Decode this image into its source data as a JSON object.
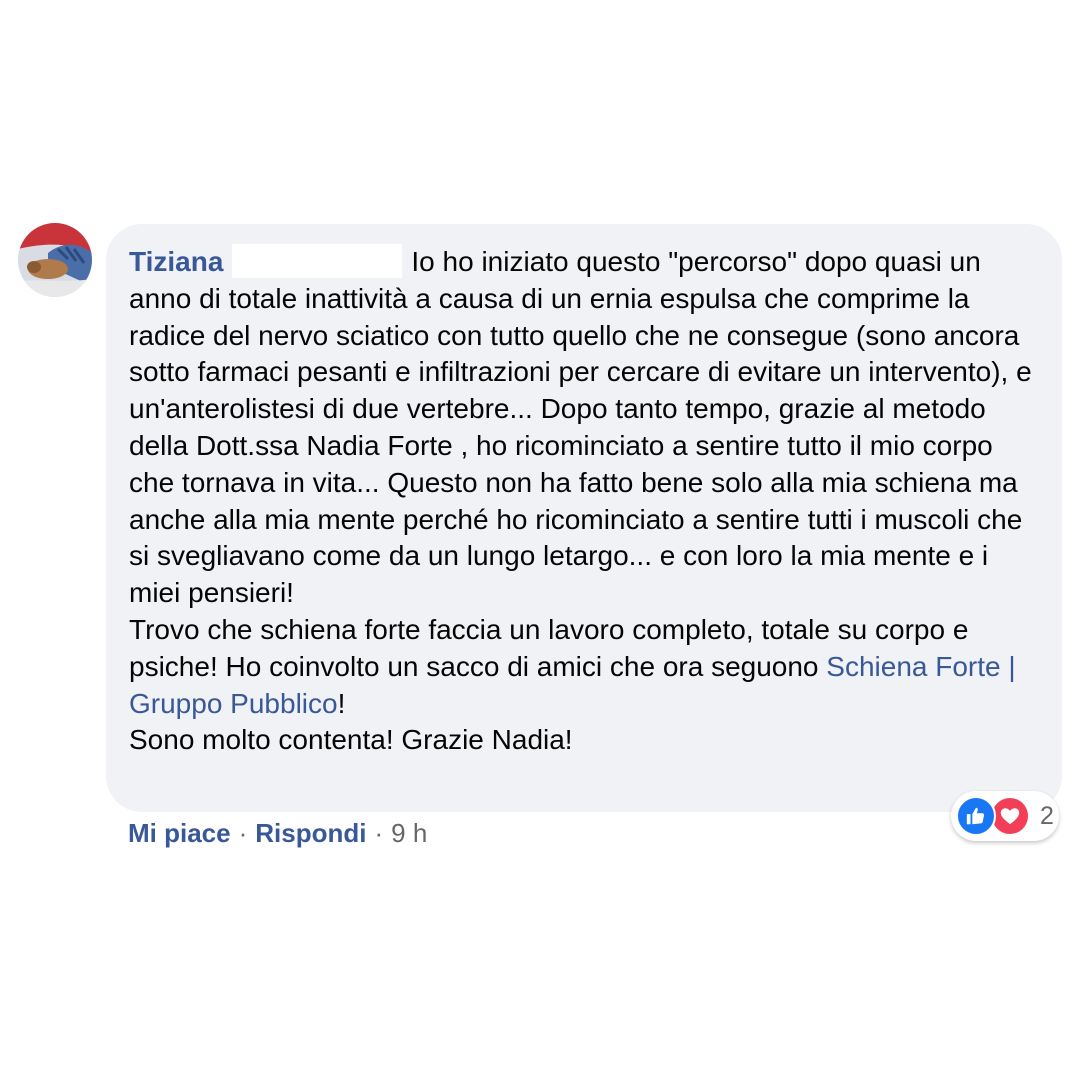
{
  "comment": {
    "author": "Tiziana",
    "text_part1": "Io ho iniziato questo \"percorso\" dopo quasi un anno di totale inattività a causa di un ernia espulsa che comprime la radice del nervo sciatico con tutto quello che ne consegue (sono ancora sotto farmaci pesanti e infiltrazioni per cercare di evitare un intervento), e un'anterolistesi di due vertebre... Dopo tanto tempo, grazie al metodo della Dott.ssa Nadia Forte , ho ricominciato a sentire tutto il mio corpo che tornava in vita... Questo non ha fatto bene solo alla mia schiena ma anche alla mia mente perché ho ricominciato a sentire tutti i muscoli che si svegliavano come da un lungo letargo... e con loro la mia mente e i miei pensieri!",
    "text_part2": "Trovo che schiena forte faccia un lavoro completo, totale su corpo e psiche! Ho coinvolto un sacco di amici che ora seguono",
    "link_text": "Schiena Forte | Gruppo Pubblico",
    "text_after_link": "!",
    "text_part3": "Sono molto contenta! Grazie Nadia!"
  },
  "reactions": {
    "icons": [
      "like-icon",
      "love-icon"
    ],
    "count": "2"
  },
  "actions": {
    "like": "Mi piace",
    "separator": "·",
    "reply": "Rispondi",
    "time": "9 h"
  },
  "colors": {
    "link": "#385898",
    "bubble": "#f0f2f5",
    "like": "#1877f2",
    "love": "#f33e58"
  }
}
